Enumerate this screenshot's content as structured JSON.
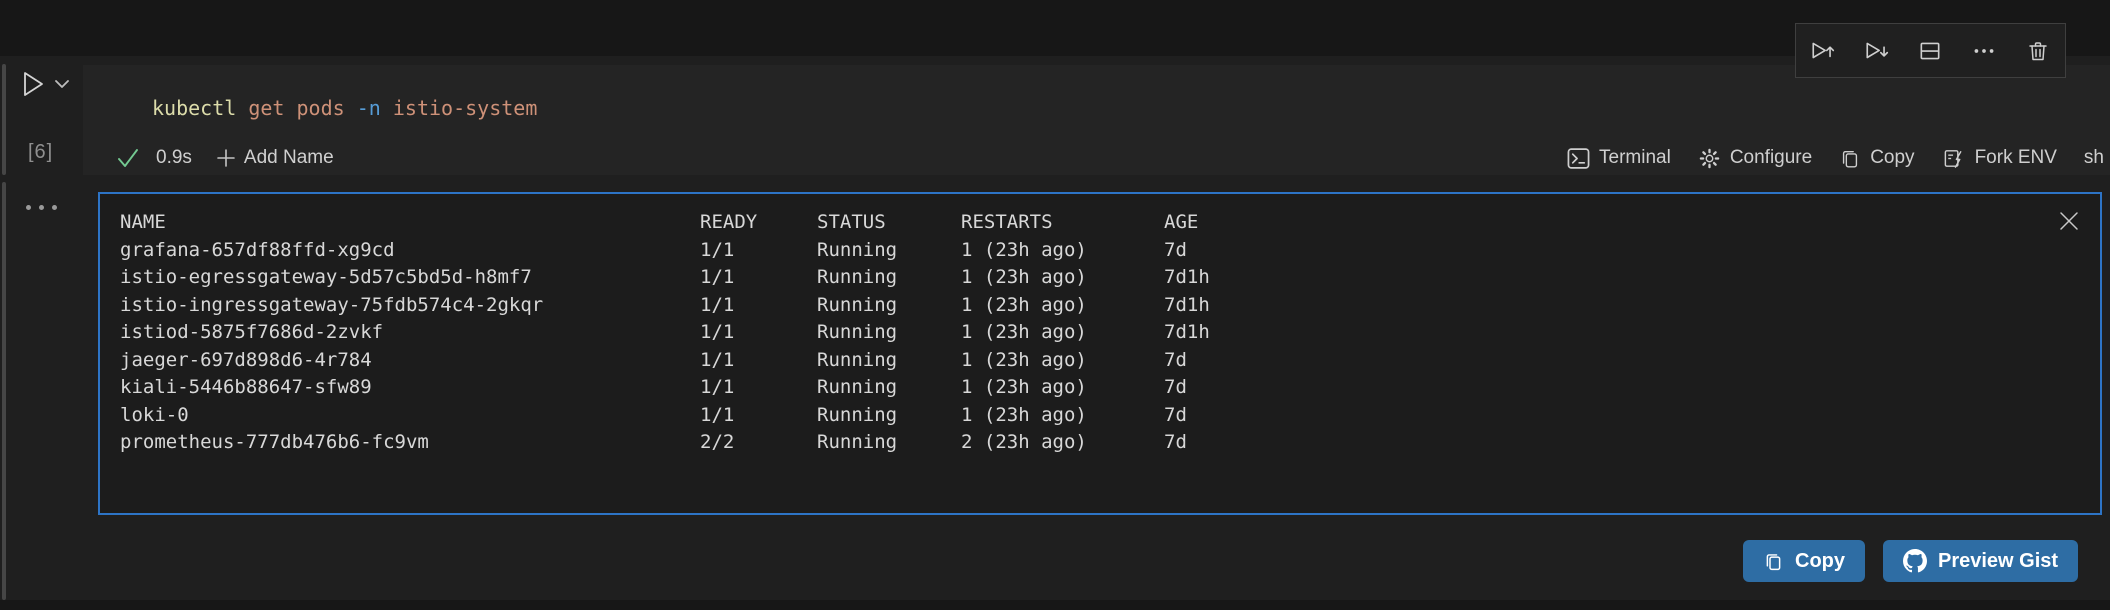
{
  "cell": {
    "execution_count": "[6]",
    "command_tokens": [
      {
        "text": "kubectl",
        "color": "#dcdcaa"
      },
      {
        "text": " ",
        "color": "#cccccc"
      },
      {
        "text": "get",
        "color": "#ce9178"
      },
      {
        "text": " ",
        "color": "#cccccc"
      },
      {
        "text": "pods",
        "color": "#ce9178"
      },
      {
        "text": " ",
        "color": "#cccccc"
      },
      {
        "text": "-n",
        "color": "#569cd6"
      },
      {
        "text": " ",
        "color": "#cccccc"
      },
      {
        "text": "istio-system",
        "color": "#ce9178"
      }
    ],
    "result": {
      "duration": "0.9s",
      "add_name_label": "Add Name"
    },
    "actions": {
      "terminal": "Terminal",
      "configure": "Configure",
      "copy": "Copy",
      "fork_env": "Fork ENV",
      "language": "sh"
    },
    "toolbar_icons": [
      "execute-above-icon",
      "execute-below-icon",
      "split-cell-icon",
      "more-actions-icon",
      "delete-cell-icon"
    ]
  },
  "output": {
    "table": {
      "headers": [
        "NAME",
        "READY",
        "STATUS",
        "RESTARTS",
        "AGE"
      ],
      "rows": [
        [
          "grafana-657df88ffd-xg9cd",
          "1/1",
          "Running",
          "1 (23h ago)",
          "7d"
        ],
        [
          "istio-egressgateway-5d57c5bd5d-h8mf7",
          "1/1",
          "Running",
          "1 (23h ago)",
          "7d1h"
        ],
        [
          "istio-ingressgateway-75fdb574c4-2gkqr",
          "1/1",
          "Running",
          "1 (23h ago)",
          "7d1h"
        ],
        [
          "istiod-5875f7686d-2zvkf",
          "1/1",
          "Running",
          "1 (23h ago)",
          "7d1h"
        ],
        [
          "jaeger-697d898d6-4r784",
          "1/1",
          "Running",
          "1 (23h ago)",
          "7d"
        ],
        [
          "kiali-5446b88647-sfw89",
          "1/1",
          "Running",
          "1 (23h ago)",
          "7d"
        ],
        [
          "loki-0",
          "1/1",
          "Running",
          "1 (23h ago)",
          "7d"
        ],
        [
          "prometheus-777db476b6-fc9vm",
          "2/2",
          "Running",
          "2 (23h ago)",
          "7d"
        ]
      ]
    }
  },
  "footer": {
    "copy_label": "Copy",
    "preview_gist_label": "Preview Gist"
  },
  "colors": {
    "focus_border_blue": "#2d74c6",
    "button_blue": "#2e6da4",
    "success_green": "#73c991",
    "syntax_command": "#dcdcaa",
    "syntax_string": "#ce9178",
    "syntax_flag": "#569cd6"
  }
}
